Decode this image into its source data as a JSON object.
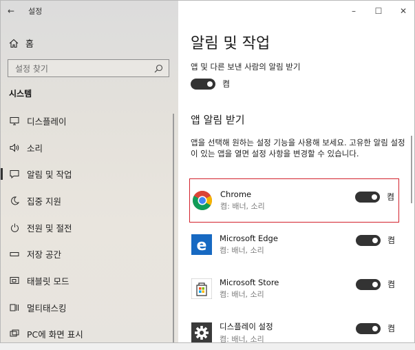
{
  "window": {
    "title": "설정",
    "controls": {
      "minimize": "–",
      "maximize": "☐",
      "close": "✕"
    }
  },
  "sidebar": {
    "back_glyph": "←",
    "home_label": "홈",
    "search_placeholder": "설정 찾기",
    "section_title": "시스템",
    "items": [
      {
        "label": "디스플레이",
        "icon": "monitor-icon"
      },
      {
        "label": "소리",
        "icon": "speaker-icon"
      },
      {
        "label": "알림 및 작업",
        "icon": "notification-icon",
        "active": true
      },
      {
        "label": "집중 지원",
        "icon": "moon-icon"
      },
      {
        "label": "전원 및 절전",
        "icon": "power-icon"
      },
      {
        "label": "저장 공간",
        "icon": "storage-icon"
      },
      {
        "label": "태블릿 모드",
        "icon": "tablet-mode-icon"
      },
      {
        "label": "멀티태스킹",
        "icon": "multitasking-icon"
      },
      {
        "label": "PC에 화면 표시",
        "icon": "project-icon"
      }
    ]
  },
  "main": {
    "title": "알림 및 작업",
    "notify_desc": "앱 및 다른 보낸 사람의 알림 받기",
    "master_toggle_state": "켬",
    "apps_title": "앱 알림 받기",
    "apps_desc": "앱을 선택해 원하는 설정 기능을 사용해 보세요. 고유한 알림 설정이 있는 앱을 열면 설정 사항을 변경할 수 있습니다.",
    "apps": [
      {
        "name": "Chrome",
        "sub": "켬: 배너, 소리",
        "state": "켬",
        "icon": "chrome-icon",
        "highlighted": true
      },
      {
        "name": "Microsoft Edge",
        "sub": "켬: 배너, 소리",
        "state": "켬",
        "icon": "edge-icon"
      },
      {
        "name": "Microsoft Store",
        "sub": "켬: 배너, 소리",
        "state": "켬",
        "icon": "store-icon"
      },
      {
        "name": "디스플레이 설정",
        "sub": "켬: 배너, 소리",
        "state": "켬",
        "icon": "display-settings-icon"
      }
    ]
  },
  "colors": {
    "accent_toggle": "#333333",
    "highlight_border": "#d21f2a",
    "edge_blue": "#1769c2"
  }
}
